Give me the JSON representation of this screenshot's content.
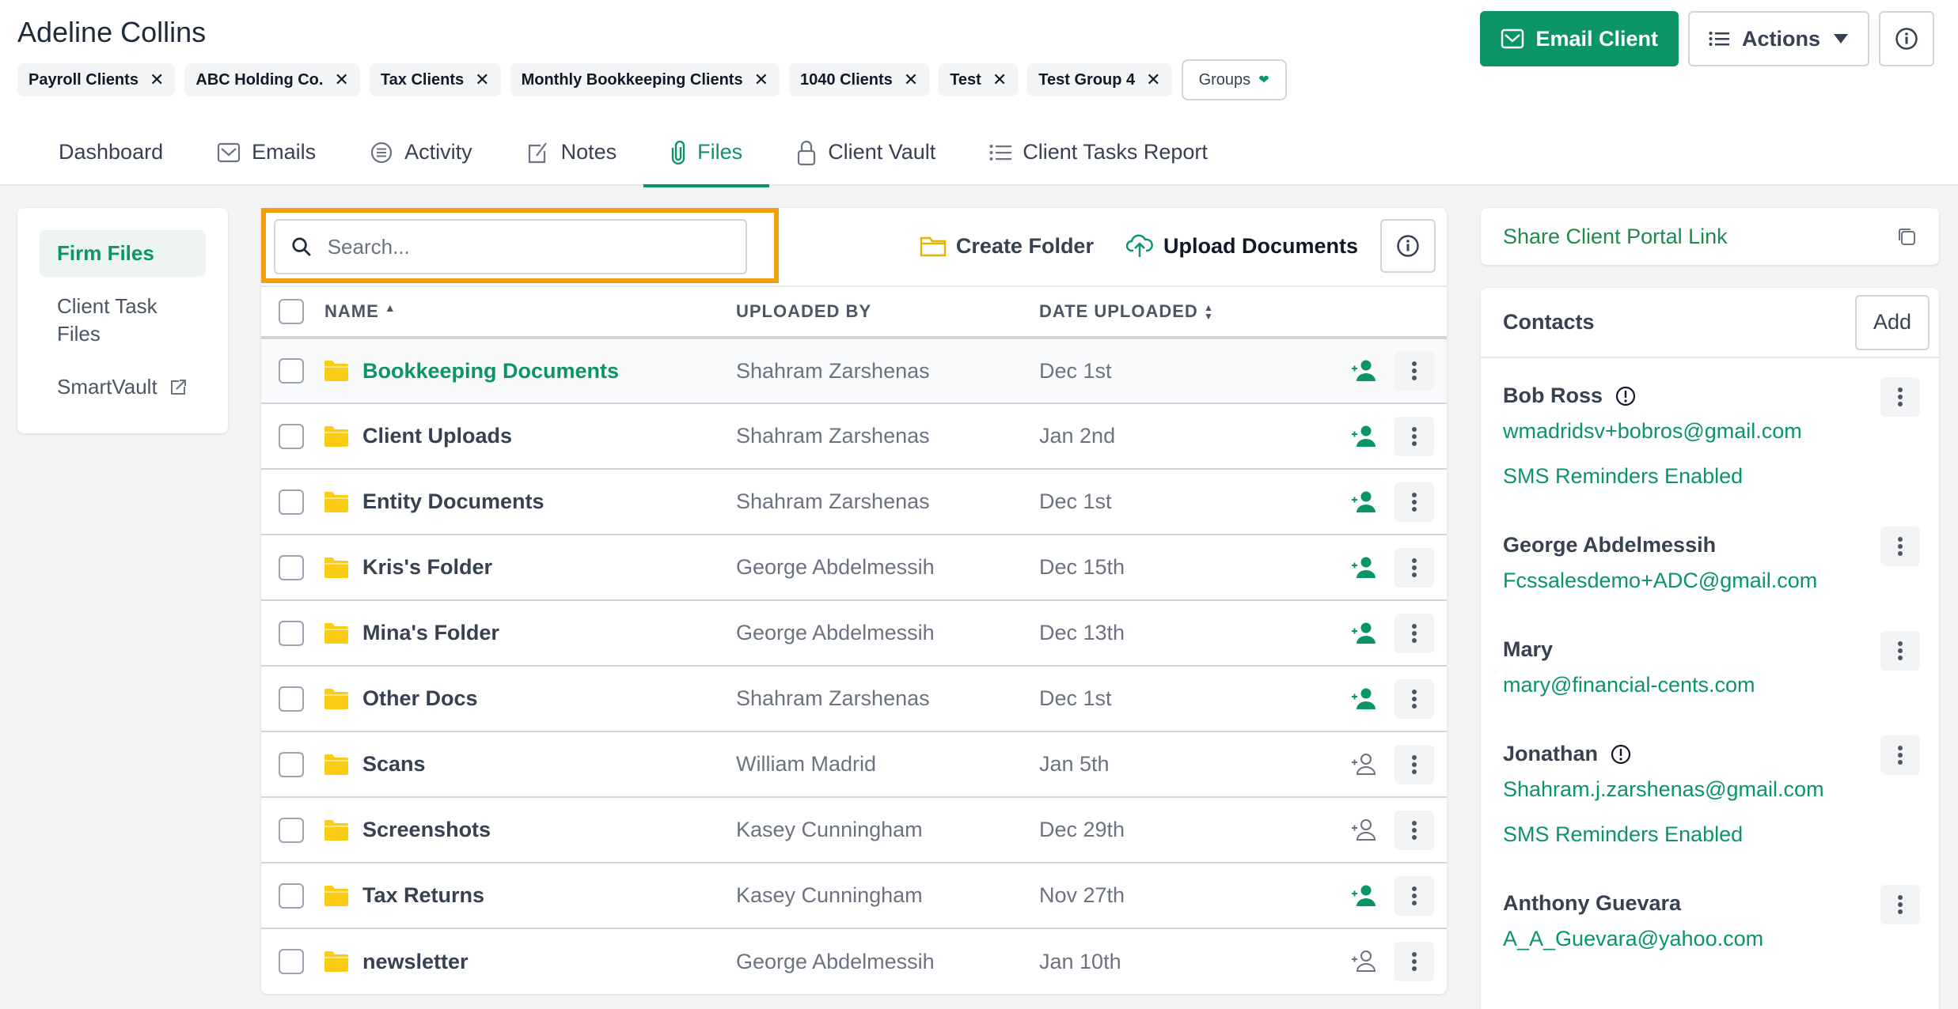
{
  "header": {
    "client_name": "Adeline Collins",
    "tags": [
      {
        "label": "Payroll Clients"
      },
      {
        "label": "ABC Holding Co."
      },
      {
        "label": "Tax Clients"
      },
      {
        "label": "Monthly Bookkeeping Clients"
      },
      {
        "label": "1040 Clients"
      },
      {
        "label": "Test"
      },
      {
        "label": "Test Group 4"
      }
    ],
    "groups_label": "Groups",
    "email_client_label": "Email Client",
    "actions_label": "Actions"
  },
  "tabs": [
    {
      "label": "Dashboard",
      "icon": "none"
    },
    {
      "label": "Emails",
      "icon": "mail-icon"
    },
    {
      "label": "Activity",
      "icon": "list-circle-icon"
    },
    {
      "label": "Notes",
      "icon": "edit-icon"
    },
    {
      "label": "Files",
      "icon": "paperclip-icon",
      "active": true
    },
    {
      "label": "Client Vault",
      "icon": "lock-icon"
    },
    {
      "label": "Client Tasks Report",
      "icon": "list-icon"
    }
  ],
  "sidebar": {
    "items": [
      {
        "label": "Firm Files",
        "active": true
      },
      {
        "label": "Client Task Files"
      },
      {
        "label": "SmartVault",
        "external": true
      }
    ]
  },
  "files": {
    "search_placeholder": "Search...",
    "create_folder_label": "Create Folder",
    "upload_label": "Upload Documents",
    "columns": {
      "name": "NAME",
      "uploaded_by": "UPLOADED BY",
      "date_uploaded": "DATE UPLOADED"
    },
    "rows": [
      {
        "name": "Bookkeeping Documents",
        "uploaded_by": "Shahram Zarshenas",
        "date": "Dec 1st",
        "shared": true
      },
      {
        "name": "Client Uploads",
        "uploaded_by": "Shahram Zarshenas",
        "date": "Jan 2nd",
        "shared": true
      },
      {
        "name": "Entity Documents",
        "uploaded_by": "Shahram Zarshenas",
        "date": "Dec 1st",
        "shared": true
      },
      {
        "name": "Kris's Folder",
        "uploaded_by": "George Abdelmessih",
        "date": "Dec 15th",
        "shared": true
      },
      {
        "name": "Mina's Folder",
        "uploaded_by": "George Abdelmessih",
        "date": "Dec 13th",
        "shared": true
      },
      {
        "name": "Other Docs",
        "uploaded_by": "Shahram Zarshenas",
        "date": "Dec 1st",
        "shared": true
      },
      {
        "name": "Scans",
        "uploaded_by": "William Madrid",
        "date": "Jan 5th",
        "shared": false
      },
      {
        "name": "Screenshots",
        "uploaded_by": "Kasey Cunningham",
        "date": "Dec 29th",
        "shared": false
      },
      {
        "name": "Tax Returns",
        "uploaded_by": "Kasey Cunningham",
        "date": "Nov 27th",
        "shared": true
      },
      {
        "name": "newsletter",
        "uploaded_by": "George Abdelmessih",
        "date": "Jan 10th",
        "shared": false
      }
    ]
  },
  "right_panel": {
    "share_link_label": "Share Client Portal Link",
    "contacts_title": "Contacts",
    "add_label": "Add",
    "contacts": [
      {
        "name": "Bob Ross",
        "email": "wmadridsv+bobros@gmail.com",
        "sms": "SMS Reminders Enabled",
        "warning": true
      },
      {
        "name": "George Abdelmessih",
        "email": "Fcssalesdemo+ADC@gmail.com",
        "sms": null,
        "warning": false
      },
      {
        "name": "Mary",
        "email": "mary@financial-cents.com",
        "sms": null,
        "warning": false
      },
      {
        "name": "Jonathan",
        "email": "Shahram.j.zarshenas@gmail.com",
        "sms": "SMS Reminders Enabled",
        "warning": true
      },
      {
        "name": "Anthony Guevara",
        "email": "A_A_Guevara@yahoo.com",
        "sms": null,
        "warning": false
      }
    ]
  },
  "colors": {
    "brand_green": "#0a9467",
    "highlight_orange": "#f59e0b",
    "folder_yellow": "#facc15"
  }
}
